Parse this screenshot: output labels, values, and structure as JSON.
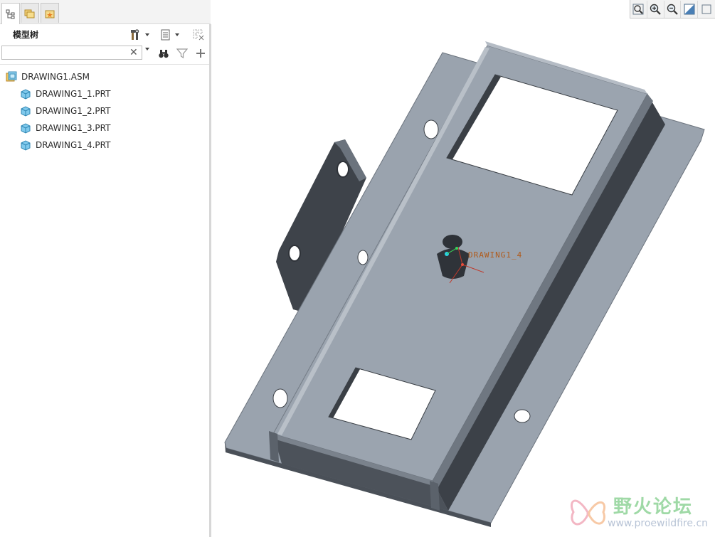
{
  "tabs": [
    {
      "name": "model-tree",
      "icon": "model-tree-icon"
    },
    {
      "name": "folder-browser",
      "icon": "folder-browser-icon"
    },
    {
      "name": "favorites",
      "icon": "favorites-icon"
    }
  ],
  "panel": {
    "title": "模型树",
    "settings_icon": "tree-settings-icon",
    "show_icon": "tree-columns-icon",
    "filter_icon": "tree-filter-icon"
  },
  "search": {
    "value": "",
    "placeholder": "",
    "clear_glyph": "✕"
  },
  "tree": {
    "root": {
      "label": "DRAWING1.ASM",
      "icon": "assembly-icon"
    },
    "items": [
      {
        "label": "DRAWING1_1.PRT",
        "icon": "part-icon"
      },
      {
        "label": "DRAWING1_2.PRT",
        "icon": "part-icon"
      },
      {
        "label": "DRAWING1_3.PRT",
        "icon": "part-icon"
      },
      {
        "label": "DRAWING1_4.PRT",
        "icon": "part-icon"
      }
    ]
  },
  "view_toolbar": [
    {
      "name": "refit-icon"
    },
    {
      "name": "zoom-in-icon"
    },
    {
      "name": "zoom-out-icon"
    },
    {
      "name": "repaint-icon"
    }
  ],
  "graphics": {
    "feature_label": "DRAWING1_4",
    "colors": {
      "top_face": "#9aa3ae",
      "side_face": "#3d4249",
      "edge": "#4a5058",
      "csys": "#c0392b"
    }
  },
  "watermark": {
    "title": "野火论坛",
    "url": "www.proewildfire.cn"
  }
}
